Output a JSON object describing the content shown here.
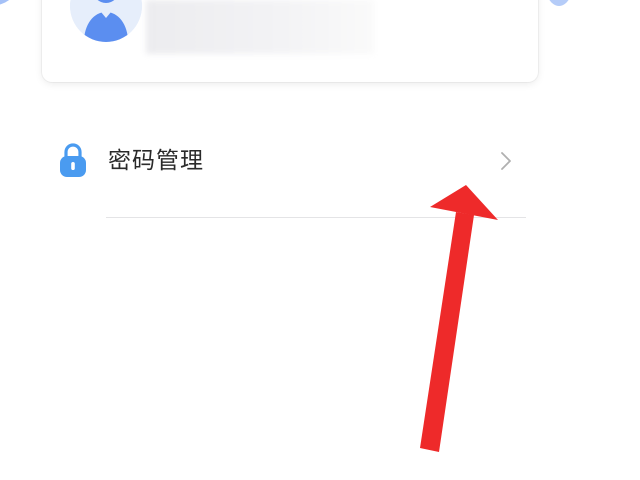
{
  "profile": {
    "avatar_icon": "user-avatar-icon",
    "name_redacted": true
  },
  "settings": {
    "password_management": {
      "label": "密码管理",
      "icon": "lock-icon",
      "chevron": "chevron-right-icon"
    }
  },
  "colors": {
    "accent_blue": "#4a9bf0",
    "avatar_blue": "#5b8ef0",
    "annotation_red": "#ee2a2a",
    "text": "#2a2a2a",
    "chevron": "#b0b0b0",
    "divider": "#e4e4e6"
  },
  "annotation": {
    "type": "arrow",
    "color_name": "red",
    "points_to": "chevron-right-icon"
  }
}
